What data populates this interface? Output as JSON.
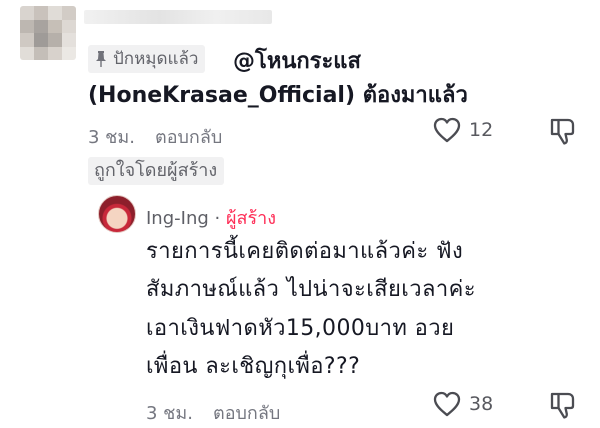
{
  "comment": {
    "pinned_label": "ปักหมุดแล้ว",
    "mention": "@โหนกระแส",
    "text_lines": [
      "(HoneKrasae_Official) ต้องมาแล้ว"
    ],
    "time": "3 ชม.",
    "reply_label": "ตอบกลับ",
    "like_count": "12",
    "creator_liked_label": "ถูกใจโดยผู้สร้าง"
  },
  "reply": {
    "author": "Ing-Ing",
    "separator": "·",
    "creator_label": "ผู้สร้าง",
    "text_lines": [
      "รายการนี้เคยติดต่อมาแล้วค่ะ ฟัง",
      "สัมภาษณ์แล้ว ไปน่าจะเสียเวลาค่ะ",
      "เอาเงินฟาดหัว15,000บาท อวย",
      "เพื่อน ละเชิญกุเพื่อ???"
    ],
    "time": "3 ชม.",
    "reply_label": "ตอบกลับ",
    "like_count": "38"
  },
  "icons": {
    "pin": "pin-icon",
    "heart": "heart-icon",
    "dislike": "thumbs-down-icon",
    "avatar_blur": "blurred-avatar"
  },
  "colors": {
    "text": "#161823",
    "secondary": "#757780",
    "creator_accent": "#fe2c55",
    "pill_bg": "#f1f1f2"
  }
}
